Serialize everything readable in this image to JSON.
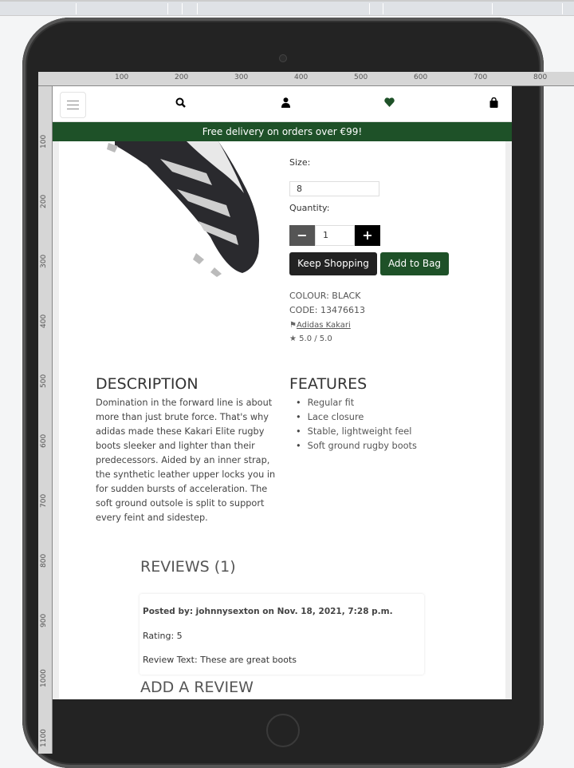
{
  "ruler": {
    "h": [
      "100",
      "200",
      "300",
      "400",
      "500",
      "600",
      "700",
      "800"
    ],
    "v": [
      "100",
      "200",
      "300",
      "400",
      "500",
      "600",
      "700",
      "800",
      "900",
      "1000",
      "1100"
    ]
  },
  "nav": {
    "icons": [
      "menu-icon",
      "search-icon",
      "user-icon",
      "heart-icon",
      "bag-icon"
    ]
  },
  "banner": "Free delivery on orders over €99!",
  "product": {
    "size_label": "Size:",
    "size_value": "8",
    "quantity_label": "Quantity:",
    "quantity_value": "1",
    "minus": "−",
    "plus": "+",
    "keep_shopping": "Keep Shopping",
    "add_to_bag": "Add to Bag",
    "colour": "COLOUR: BLACK",
    "code": "CODE: 13476613",
    "category": "Adidas Kakari",
    "rating": "5.0 / 5.0"
  },
  "description": {
    "title": "DESCRIPTION",
    "text": "Domination in the forward line is about more than just brute force. That's why adidas made these Kakari Elite rugby boots sleeker and lighter than their predecessors. Aided by an inner strap, the synthetic leather upper locks you in for sudden bursts of acceleration. The soft ground outsole is split to support every feint and sidestep."
  },
  "features": {
    "title": "FEATURES",
    "items": [
      "Regular fit",
      "Lace closure",
      "Stable, lightweight feel",
      "Soft ground rugby boots"
    ]
  },
  "reviews": {
    "title": "REVIEWS (1)",
    "items": [
      {
        "posted": "Posted by: johnnysexton on Nov. 18, 2021, 7:28 p.m.",
        "rating": "Rating: 5",
        "text": "Review Text: These are great boots"
      }
    ],
    "add_title": "ADD A REVIEW"
  },
  "colors": {
    "brand": "#1e5128",
    "dark_button": "#222222"
  }
}
